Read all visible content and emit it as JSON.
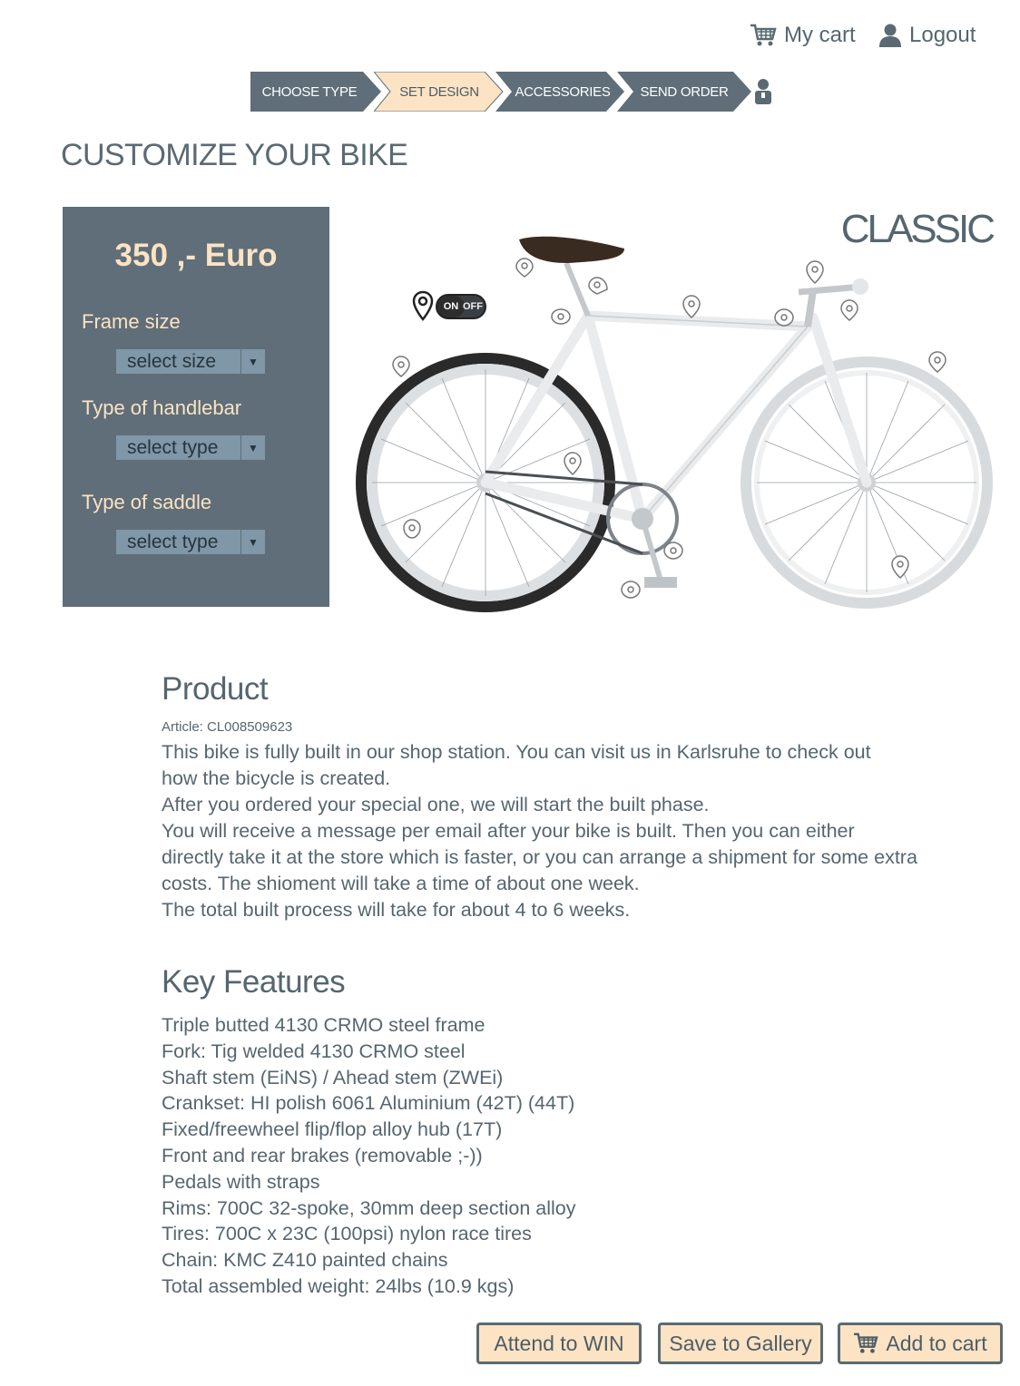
{
  "topnav": {
    "cart_label": "My cart",
    "logout_label": "Logout"
  },
  "steps": [
    {
      "label": "CHOOSE TYPE",
      "active": false
    },
    {
      "label": "SET DESIGN",
      "active": true
    },
    {
      "label": "ACCESSORIES",
      "active": false
    },
    {
      "label": "SEND ORDER",
      "active": false
    }
  ],
  "page_title": "CUSTOMIZE YOUR BIKE",
  "config": {
    "price": "350 ,- Euro",
    "frame_size": {
      "label": "Frame size",
      "value": "select size"
    },
    "handlebar": {
      "label": "Type of handlebar",
      "value": "select type"
    },
    "saddle": {
      "label": "Type of saddle",
      "value": "select type"
    }
  },
  "bike": {
    "model_name": "CLASSIC",
    "toggle_on": "ON",
    "toggle_off": "OFF"
  },
  "product": {
    "title": "Product",
    "article": "Article: CL008509623",
    "description_lines": [
      "This bike is fully built in our shop station. You can visit us in Karlsruhe to check out",
      "how the bicycle is created.",
      "After you ordered your special one, we will start the built phase.",
      "You will receive a message per email after your bike is built. Then you can either",
      "directly take it at the store which is faster, or you can arrange a shipment for some extra",
      "costs. The shioment will take a time of about one week.",
      "The total built process will take for about 4 to 6 weeks."
    ]
  },
  "features": {
    "title": "Key Features",
    "items": [
      "Triple butted 4130 CRMO steel frame",
      "Fork: Tig welded 4130 CRMO steel",
      "Shaft stem (EiNS) / Ahead stem (ZWEi)",
      "Crankset: HI polish 6061 Aluminium (42T) (44T)",
      "Fixed/freewheel flip/flop alloy hub (17T)",
      "Front and rear brakes (removable ;-))",
      "Pedals with straps",
      "Rims: 700C 32-spoke, 30mm deep section alloy",
      "Tires: 700C x 23C (100psi) nylon race tires",
      "Chain: KMC Z410 painted chains",
      "Total assembled weight: 24lbs (10.9 kgs)"
    ]
  },
  "buttons": {
    "win": "Attend to WIN",
    "gallery": "Save to Gallery",
    "cart": "Add to cart"
  },
  "colors": {
    "panel": "#5f6e78",
    "accent_cream": "#fbe3c4",
    "text": "#56666f",
    "select": "#7f97a7"
  }
}
